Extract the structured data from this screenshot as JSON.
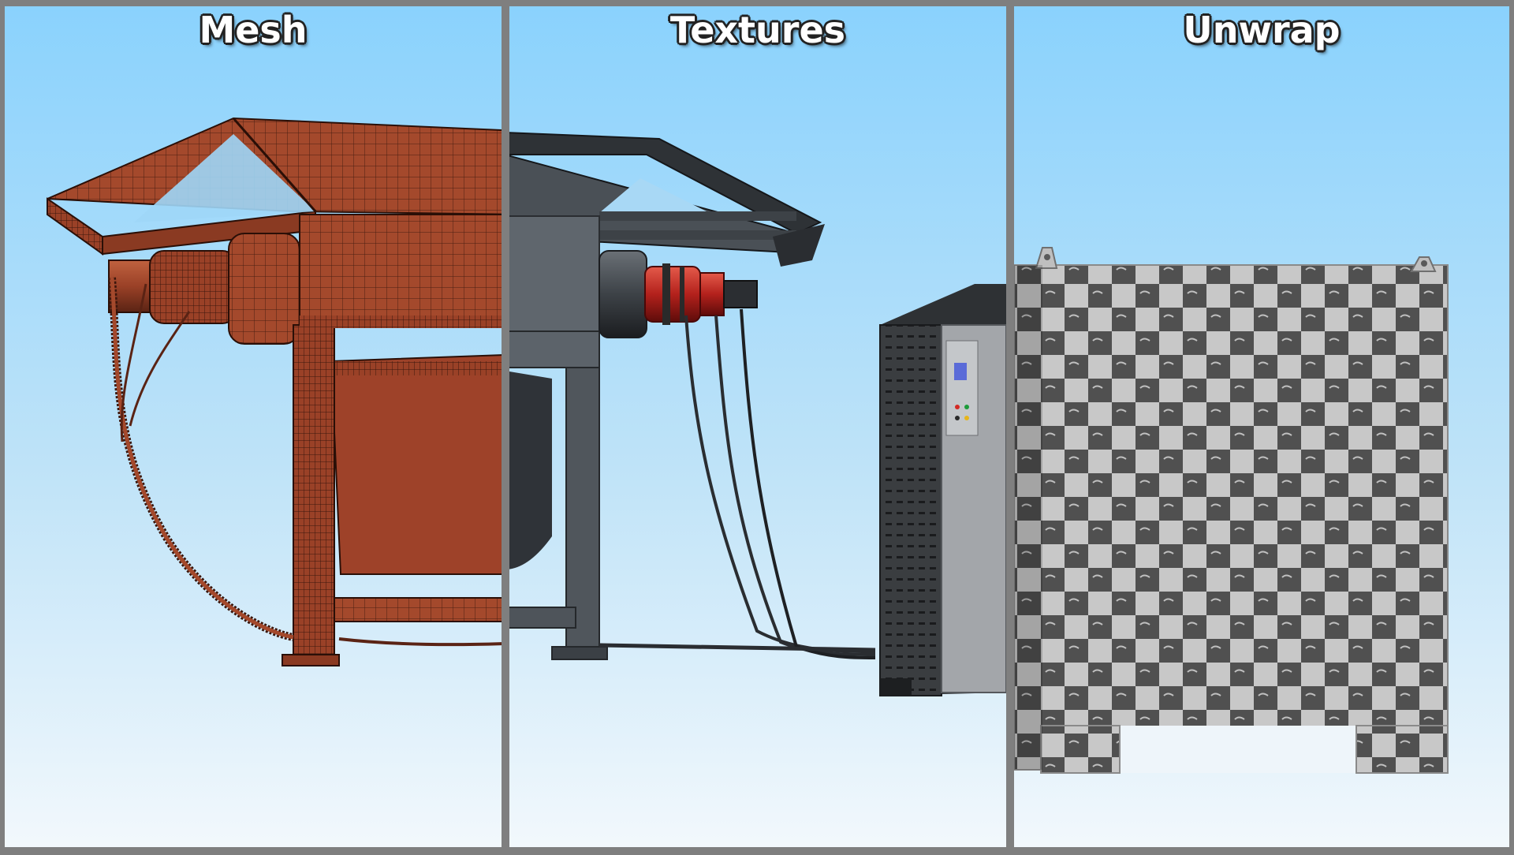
{
  "panels": [
    {
      "id": "mesh",
      "title": "Mesh"
    },
    {
      "id": "textures",
      "title": "Textures"
    },
    {
      "id": "unwrap",
      "title": "Unwrap"
    }
  ],
  "colors": {
    "frame": "#7f7f7f",
    "sky_top": "#8ad2fd",
    "sky_bottom": "#f2f8fc",
    "wire_base": "#a4492c",
    "wire_line": "#3a160c",
    "metal_dark": "#3d4247",
    "metal_mid": "#626971",
    "red_part": "#b3211c",
    "cabinet_light": "#a3a6aa",
    "checker_dark": "#505050",
    "checker_light": "#c8c8c8"
  },
  "icons": [
    "wireframe-shredder-model",
    "textured-shredder-model",
    "checker-unwrap-cabinet-model"
  ]
}
